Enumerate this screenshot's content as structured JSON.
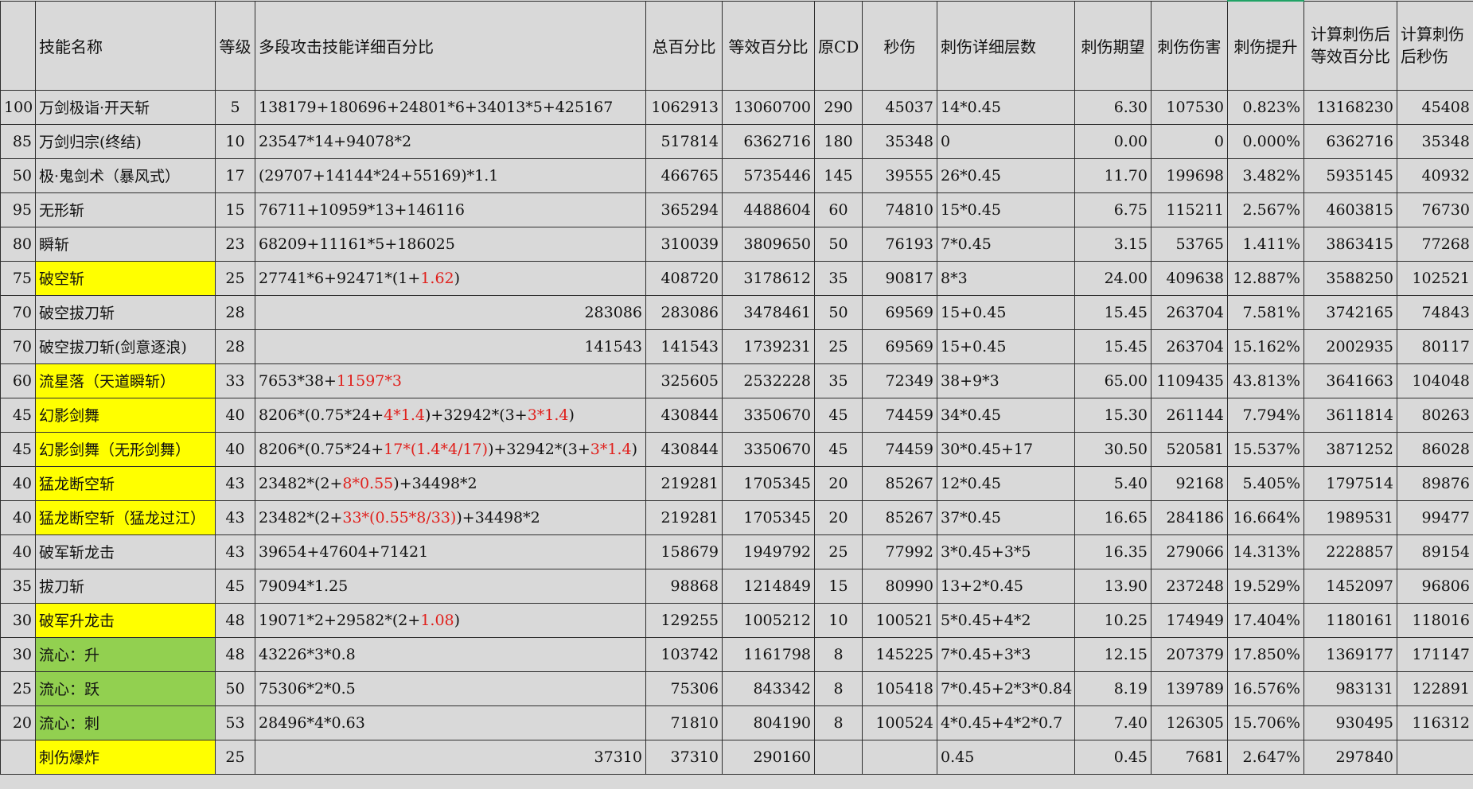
{
  "headers": {
    "lv": "",
    "name": "技能名称",
    "grade": "等级",
    "detail": "多段攻击技能详细百分比",
    "total_pct": "总百分比",
    "eq_pct": "等效百分比",
    "cd": "原CD",
    "sec_dmg": "秒伤",
    "stab_layers": "刺伤详细层数",
    "stab_expect": "刺伤期望",
    "stab_dmg": "刺伤伤害",
    "stab_boost": "刺伤提升",
    "calc_eq_pct_1": "计算刺伤后",
    "calc_eq_pct_2": "等效百分比",
    "calc_sec_1": "计算刺伤",
    "calc_sec_2": "后秒伤"
  },
  "rows": [
    {
      "lv": "100",
      "name": "万剑极诣·开天斩",
      "hl": "",
      "grade": "5",
      "detail": [
        {
          "t": "138179+180696+24801*6+34013*5+425167"
        }
      ],
      "detail_align": "l",
      "total": "1062913",
      "eq": "13060700",
      "cd": "290",
      "sec": "45037",
      "layers": "14*0.45",
      "expect": "6.30",
      "sdmg": "107530",
      "boost": "0.823%",
      "ceq": "13168230",
      "csec": "45408"
    },
    {
      "lv": "85",
      "name": "万剑归宗(终结)",
      "hl": "",
      "grade": "10",
      "detail": [
        {
          "t": "23547*14+94078*2"
        }
      ],
      "detail_align": "l",
      "total": "517814",
      "eq": "6362716",
      "cd": "180",
      "sec": "35348",
      "layers": "0",
      "expect": "0.00",
      "sdmg": "0",
      "boost": "0.000%",
      "ceq": "6362716",
      "csec": "35348"
    },
    {
      "lv": "50",
      "name": "极·鬼剑术（暴风式）",
      "hl": "",
      "grade": "17",
      "detail": [
        {
          "t": "(29707+14144*24+55169)*1.1"
        }
      ],
      "detail_align": "l",
      "total": "466765",
      "eq": "5735446",
      "cd": "145",
      "sec": "39555",
      "layers": "26*0.45",
      "expect": "11.70",
      "sdmg": "199698",
      "boost": "3.482%",
      "ceq": "5935145",
      "csec": "40932"
    },
    {
      "lv": "95",
      "name": "无形斩",
      "hl": "",
      "grade": "15",
      "detail": [
        {
          "t": "76711+10959*13+146116"
        }
      ],
      "detail_align": "l",
      "total": "365294",
      "eq": "4488604",
      "cd": "60",
      "sec": "74810",
      "layers": "15*0.45",
      "expect": "6.75",
      "sdmg": "115211",
      "boost": "2.567%",
      "ceq": "4603815",
      "csec": "76730"
    },
    {
      "lv": "80",
      "name": "瞬斩",
      "hl": "",
      "grade": "23",
      "detail": [
        {
          "t": "68209+11161*5+186025"
        }
      ],
      "detail_align": "l",
      "total": "310039",
      "eq": "3809650",
      "cd": "50",
      "sec": "76193",
      "layers": "7*0.45",
      "expect": "3.15",
      "sdmg": "53765",
      "boost": "1.411%",
      "ceq": "3863415",
      "csec": "77268"
    },
    {
      "lv": "75",
      "name": "破空斩",
      "hl": "yellow",
      "grade": "25",
      "detail": [
        {
          "t": "27741*6+92471*(1+"
        },
        {
          "t": "1.62",
          "red": true
        },
        {
          "t": ")"
        }
      ],
      "detail_align": "l",
      "total": "408720",
      "eq": "3178612",
      "cd": "35",
      "sec": "90817",
      "layers": "8*3",
      "expect": "24.00",
      "sdmg": "409638",
      "boost": "12.887%",
      "ceq": "3588250",
      "csec": "102521"
    },
    {
      "lv": "70",
      "name": "破空拔刀斩",
      "hl": "",
      "grade": "28",
      "detail": [
        {
          "t": "283086"
        }
      ],
      "detail_align": "r",
      "total": "283086",
      "eq": "3478461",
      "cd": "50",
      "sec": "69569",
      "layers": "15+0.45",
      "expect": "15.45",
      "sdmg": "263704",
      "boost": "7.581%",
      "ceq": "3742165",
      "csec": "74843"
    },
    {
      "lv": "70",
      "name": "破空拔刀斩(剑意逐浪)",
      "hl": "",
      "grade": "28",
      "detail": [
        {
          "t": "141543"
        }
      ],
      "detail_align": "r",
      "total": "141543",
      "eq": "1739231",
      "cd": "25",
      "sec": "69569",
      "layers": "15+0.45",
      "expect": "15.45",
      "sdmg": "263704",
      "boost": "15.162%",
      "ceq": "2002935",
      "csec": "80117"
    },
    {
      "lv": "60",
      "name": "流星落（天道瞬斩）",
      "hl": "yellow",
      "grade": "33",
      "detail": [
        {
          "t": "7653*38+"
        },
        {
          "t": "11597*3",
          "red": true
        }
      ],
      "detail_align": "l",
      "total": "325605",
      "eq": "2532228",
      "cd": "35",
      "sec": "72349",
      "layers": "38+9*3",
      "expect": "65.00",
      "sdmg": "1109435",
      "boost": "43.813%",
      "ceq": "3641663",
      "csec": "104048"
    },
    {
      "lv": "45",
      "name": "幻影剑舞",
      "hl": "yellow",
      "grade": "40",
      "detail": [
        {
          "t": "8206*(0.75*24+"
        },
        {
          "t": "4*1.4",
          "red": true
        },
        {
          "t": ")+32942*(3+"
        },
        {
          "t": "3*1.4",
          "red": true
        },
        {
          "t": ")"
        }
      ],
      "detail_align": "l",
      "total": "430844",
      "eq": "3350670",
      "cd": "45",
      "sec": "74459",
      "layers": "34*0.45",
      "expect": "15.30",
      "sdmg": "261144",
      "boost": "7.794%",
      "ceq": "3611814",
      "csec": "80263"
    },
    {
      "lv": "45",
      "name": "幻影剑舞（无形剑舞）",
      "hl": "yellow",
      "grade": "40",
      "detail": [
        {
          "t": "8206*(0.75*24+"
        },
        {
          "t": "17*(1.4*4/17)",
          "red": true
        },
        {
          "t": ")+32942*(3+"
        },
        {
          "t": "3*1.4",
          "red": true
        },
        {
          "t": ")"
        }
      ],
      "detail_align": "l",
      "total": "430844",
      "eq": "3350670",
      "cd": "45",
      "sec": "74459",
      "layers": "30*0.45+17",
      "expect": "30.50",
      "sdmg": "520581",
      "boost": "15.537%",
      "ceq": "3871252",
      "csec": "86028"
    },
    {
      "lv": "40",
      "name": "猛龙断空斩",
      "hl": "yellow",
      "grade": "43",
      "detail": [
        {
          "t": "23482*(2+"
        },
        {
          "t": "8*0.55",
          "red": true
        },
        {
          "t": ")+34498*2"
        }
      ],
      "detail_align": "l",
      "total": "219281",
      "eq": "1705345",
      "cd": "20",
      "sec": "85267",
      "layers": "12*0.45",
      "expect": "5.40",
      "sdmg": "92168",
      "boost": "5.405%",
      "ceq": "1797514",
      "csec": "89876"
    },
    {
      "lv": "40",
      "name": "猛龙断空斩（猛龙过江）",
      "hl": "yellow",
      "grade": "43",
      "detail": [
        {
          "t": "23482*(2+"
        },
        {
          "t": "33*(0.55*8/33)",
          "red": true
        },
        {
          "t": ")+34498*2"
        }
      ],
      "detail_align": "l",
      "total": "219281",
      "eq": "1705345",
      "cd": "20",
      "sec": "85267",
      "layers": "37*0.45",
      "expect": "16.65",
      "sdmg": "284186",
      "boost": "16.664%",
      "ceq": "1989531",
      "csec": "99477"
    },
    {
      "lv": "40",
      "name": "破军斩龙击",
      "hl": "",
      "grade": "43",
      "detail": [
        {
          "t": "39654+47604+71421"
        }
      ],
      "detail_align": "l",
      "total": "158679",
      "eq": "1949792",
      "cd": "25",
      "sec": "77992",
      "layers": "3*0.45+3*5",
      "expect": "16.35",
      "sdmg": "279066",
      "boost": "14.313%",
      "ceq": "2228857",
      "csec": "89154"
    },
    {
      "lv": "35",
      "name": "拔刀斩",
      "hl": "",
      "grade": "45",
      "detail": [
        {
          "t": "79094*1.25"
        }
      ],
      "detail_align": "l",
      "total": "98868",
      "eq": "1214849",
      "cd": "15",
      "sec": "80990",
      "layers": "13+2*0.45",
      "expect": "13.90",
      "sdmg": "237248",
      "boost": "19.529%",
      "ceq": "1452097",
      "csec": "96806"
    },
    {
      "lv": "30",
      "name": "破军升龙击",
      "hl": "yellow",
      "grade": "48",
      "detail": [
        {
          "t": "19071*2+29582*(2+"
        },
        {
          "t": "1.08",
          "red": true
        },
        {
          "t": ")"
        }
      ],
      "detail_align": "l",
      "total": "129255",
      "eq": "1005212",
      "cd": "10",
      "sec": "100521",
      "layers": "5*0.45+4*2",
      "expect": "10.25",
      "sdmg": "174949",
      "boost": "17.404%",
      "ceq": "1180161",
      "csec": "118016"
    },
    {
      "lv": "30",
      "name": "流心：升",
      "hl": "green",
      "grade": "48",
      "detail": [
        {
          "t": "43226*3*0.8"
        }
      ],
      "detail_align": "l",
      "total": "103742",
      "eq": "1161798",
      "cd": "8",
      "sec": "145225",
      "layers": "7*0.45+3*3",
      "expect": "12.15",
      "sdmg": "207379",
      "boost": "17.850%",
      "ceq": "1369177",
      "csec": "171147"
    },
    {
      "lv": "25",
      "name": "流心：跃",
      "hl": "green",
      "grade": "50",
      "detail": [
        {
          "t": "75306*2*0.5"
        }
      ],
      "detail_align": "l",
      "total": "75306",
      "eq": "843342",
      "cd": "8",
      "sec": "105418",
      "layers": "7*0.45+2*3*0.84",
      "expect": "8.19",
      "sdmg": "139789",
      "boost": "16.576%",
      "ceq": "983131",
      "csec": "122891"
    },
    {
      "lv": "20",
      "name": "流心：刺",
      "hl": "green",
      "grade": "53",
      "detail": [
        {
          "t": "28496*4*0.63"
        }
      ],
      "detail_align": "l",
      "total": "71810",
      "eq": "804190",
      "cd": "8",
      "sec": "100524",
      "layers": "4*0.45+4*2*0.7",
      "expect": "7.40",
      "sdmg": "126305",
      "boost": "15.706%",
      "ceq": "930495",
      "csec": "116312"
    },
    {
      "lv": "",
      "name": "刺伤爆炸",
      "hl": "yellow",
      "grade": "25",
      "detail": [
        {
          "t": "37310"
        }
      ],
      "detail_align": "r",
      "total": "37310",
      "eq": "290160",
      "cd": "",
      "sec": "",
      "layers": "0.45",
      "expect": "0.45",
      "sdmg": "7681",
      "boost": "2.647%",
      "ceq": "297840",
      "csec": ""
    }
  ],
  "colors": {
    "background": "#d9d9d9",
    "yellow_highlight": "#ffff00",
    "green_highlight": "#92d050",
    "red_text": "#e0201c",
    "grid": "#2e2e2e"
  }
}
